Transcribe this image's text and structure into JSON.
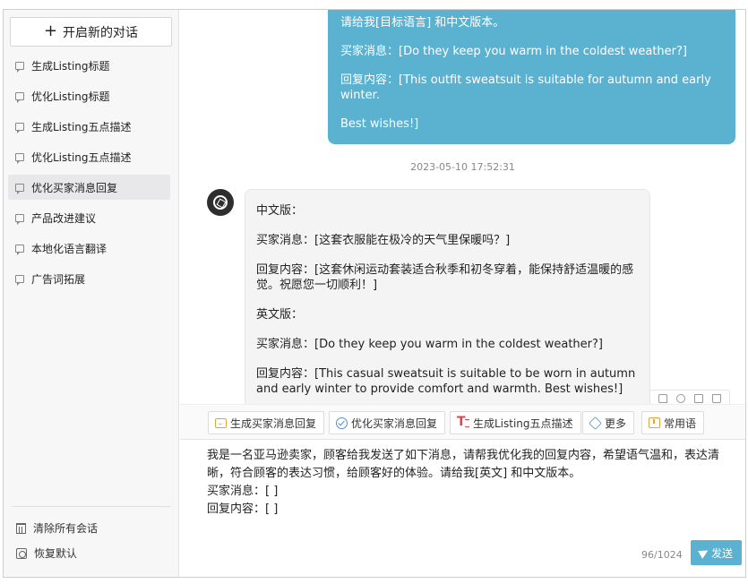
{
  "sidebar": {
    "new_chat_plus": "+",
    "new_chat_label": "开启新的对话",
    "items": [
      {
        "label": "生成Listing标题"
      },
      {
        "label": "优化Listing标题"
      },
      {
        "label": "生成Listing五点描述"
      },
      {
        "label": "优化Listing五点描述"
      },
      {
        "label": "优化买家消息回复"
      },
      {
        "label": "产品改进建议"
      },
      {
        "label": "本地化语言翻译"
      },
      {
        "label": "广告词拓展"
      }
    ],
    "active_index": 4,
    "clear_all_label": "清除所有会话",
    "restore_default_label": "恢复默认"
  },
  "conversation": {
    "user_message": {
      "line1": "请给我[目标语言] 和中文版本。",
      "buyer": "买家消息：[Do they keep you warm in the coldest weather?]",
      "reply": "回复内容：[This outfit sweatsuit is suitable for autumn and early winter.",
      "closing": "Best wishes!]"
    },
    "timestamp": "2023-05-10 17:52:31",
    "bot_message": {
      "cn_heading": "中文版：",
      "cn_buyer": "买家消息：[这套衣服能在极冷的天气里保暖吗？]",
      "cn_reply": "回复内容：[这套休闲运动套装适合秋季和初冬穿着，能保持舒适温暖的感觉。祝愿您一切顺利！]",
      "en_heading": "英文版：",
      "en_buyer": "买家消息：[Do they keep you warm in the coldest weather?]",
      "en_reply": "回复内容：[This casual sweatsuit is suitable to be worn in autumn and early winter to provide comfort and warmth. Best wishes!]"
    }
  },
  "toolbar": {
    "chips": [
      {
        "label": "生成买家消息回复",
        "icon": "reply-icon"
      },
      {
        "label": "优化买家消息回复",
        "icon": "optimize-icon"
      },
      {
        "label": "生成Listing五点描述",
        "icon": "text-icon"
      },
      {
        "label": "更多",
        "icon": "cube-icon"
      },
      {
        "label": "常用语",
        "icon": "phrase-icon"
      }
    ]
  },
  "input": {
    "value": "我是一名亚马逊卖家，顾客给我发送了如下消息，请帮我优化我的回复内容，希望语气温和，表达清晰，符合顾客的表达习惯，给顾客好的体验。请给我[英文] 和中文版本。\n买家消息：[ ]\n回复内容：[ ]",
    "counter": "96/1024",
    "send_label": "发送"
  },
  "colors": {
    "accent": "#5ab2d0",
    "sidebar_bg": "#f7f7f8",
    "bot_bubble_bg": "#f4f4f5"
  }
}
